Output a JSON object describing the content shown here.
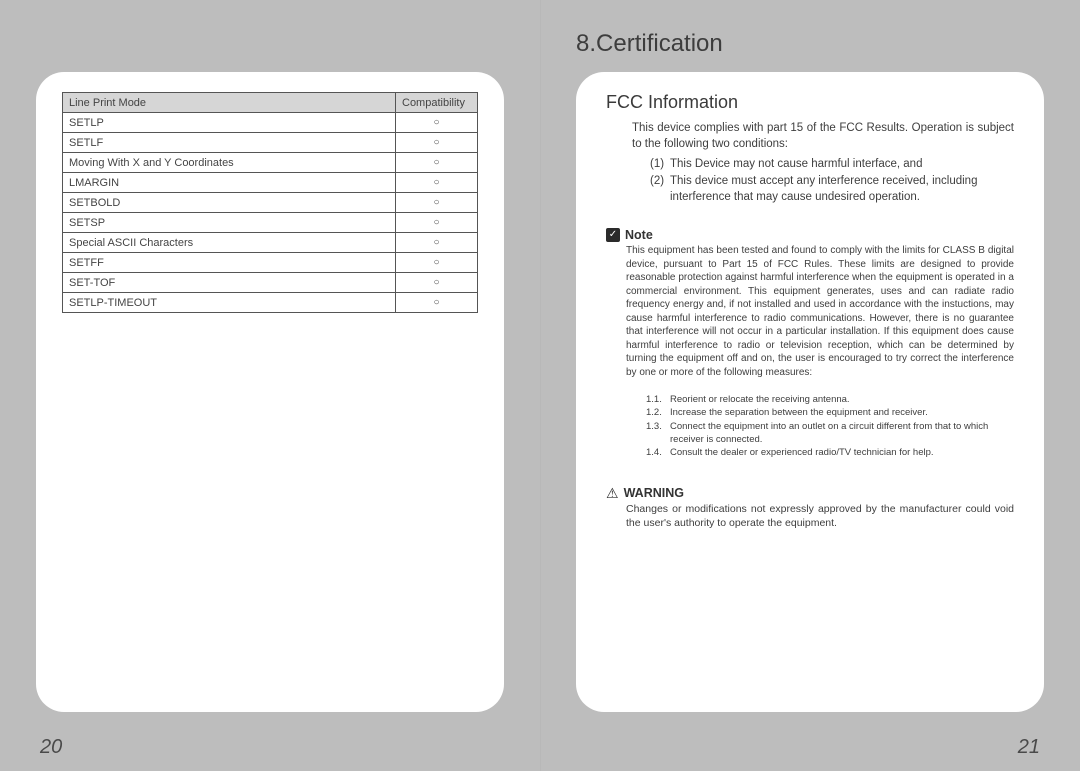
{
  "section_title": "8.Certification",
  "left": {
    "page_number": "20",
    "table": {
      "headers": [
        "Line Print Mode",
        "Compatibility"
      ],
      "rows": [
        {
          "name": "SETLP",
          "mark": "○"
        },
        {
          "name": "SETLF",
          "mark": "○"
        },
        {
          "name": "Moving With X and Y Coordinates",
          "mark": "○"
        },
        {
          "name": "LMARGIN",
          "mark": "○"
        },
        {
          "name": "SETBOLD",
          "mark": "○"
        },
        {
          "name": "SETSP",
          "mark": "○"
        },
        {
          "name": "Special ASCII Characters",
          "mark": "○"
        },
        {
          "name": "SETFF",
          "mark": "○"
        },
        {
          "name": "SET-TOF",
          "mark": "○"
        },
        {
          "name": "SETLP-TIMEOUT",
          "mark": "○"
        }
      ]
    }
  },
  "right": {
    "page_number": "21",
    "fcc_heading": "FCC Information",
    "intro": "This device complies with part 15 of the FCC Results. Operation is subject to the following two conditions:",
    "conditions": [
      {
        "num": "(1)",
        "text": "This Device may not cause harmful interface, and"
      },
      {
        "num": "(2)",
        "text": "This device must accept any interference received, including interference that may cause undesired operation."
      }
    ],
    "note_label": "Note",
    "note_body": "This equipment has been tested and found to comply with the limits for CLASS B digital device, pursuant to Part 15 of FCC Rules. These limits are designed to provide reasonable protection against harmful interference when the equipment is operated in a commercial environment. This equipment generates, uses and can radiate radio frequency energy and, if not installed and used in accordance with the instuctions, may cause harmful interference to radio communications. However, there is no guarantee that interference will not occur in a particular installation. If this equipment does cause harmful interference to radio or television reception, which can be determined by turning the equipment off and on, the user is encouraged to try correct the interference by one or more of the following measures:",
    "measures": [
      {
        "num": "1.1.",
        "text": "Reorient or relocate the receiving antenna."
      },
      {
        "num": "1.2.",
        "text": "Increase the separation between the equipment and receiver."
      },
      {
        "num": "1.3.",
        "text": "Connect the equipment into an outlet on a circuit different from that to which receiver is connected."
      },
      {
        "num": "1.4.",
        "text": "Consult the dealer or experienced radio/TV technician for help."
      }
    ],
    "warning_label": "WARNING",
    "warning_body": "Changes or modifications not expressly approved by the manufacturer could void the user's authority to operate the equipment."
  }
}
